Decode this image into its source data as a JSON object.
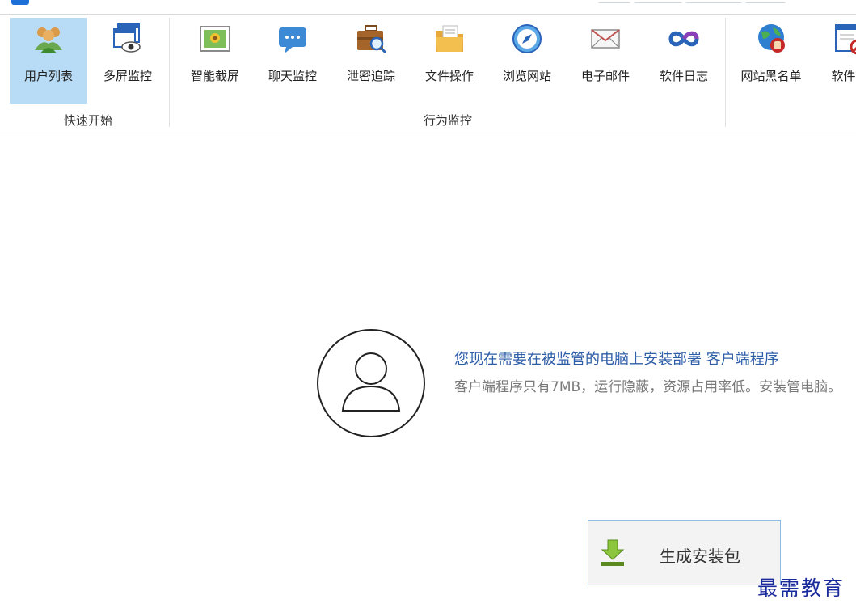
{
  "ribbon": {
    "groups": [
      {
        "label": "快速开始"
      },
      {
        "label": "行为监控"
      }
    ],
    "buttons": [
      {
        "label": "用户列表",
        "icon": "users-icon"
      },
      {
        "label": "多屏监控",
        "icon": "multi-screen-icon"
      },
      {
        "label": "智能截屏",
        "icon": "screenshot-icon"
      },
      {
        "label": "聊天监控",
        "icon": "chat-icon"
      },
      {
        "label": "泄密追踪",
        "icon": "leak-tracking-icon"
      },
      {
        "label": "文件操作",
        "icon": "folder-icon"
      },
      {
        "label": "浏览网站",
        "icon": "compass-icon"
      },
      {
        "label": "电子邮件",
        "icon": "mail-icon"
      },
      {
        "label": "软件日志",
        "icon": "infinity-icon"
      },
      {
        "label": "网站黑名单",
        "icon": "globe-block-icon"
      },
      {
        "label": "软件黑",
        "icon": "software-block-icon"
      }
    ]
  },
  "prompt": {
    "title": "您现在需要在被监管的电脑上安装部署 客户端程序",
    "description": "客户端程序只有7MB，运行隐蔽，资源占用率低。安装管电脑。"
  },
  "generate_button": {
    "label": "生成安装包"
  },
  "watermark": "最需教育",
  "colors": {
    "accent": "#b9dcf6",
    "title_blue": "#2e5ea8",
    "button_border": "#8fbce6"
  }
}
